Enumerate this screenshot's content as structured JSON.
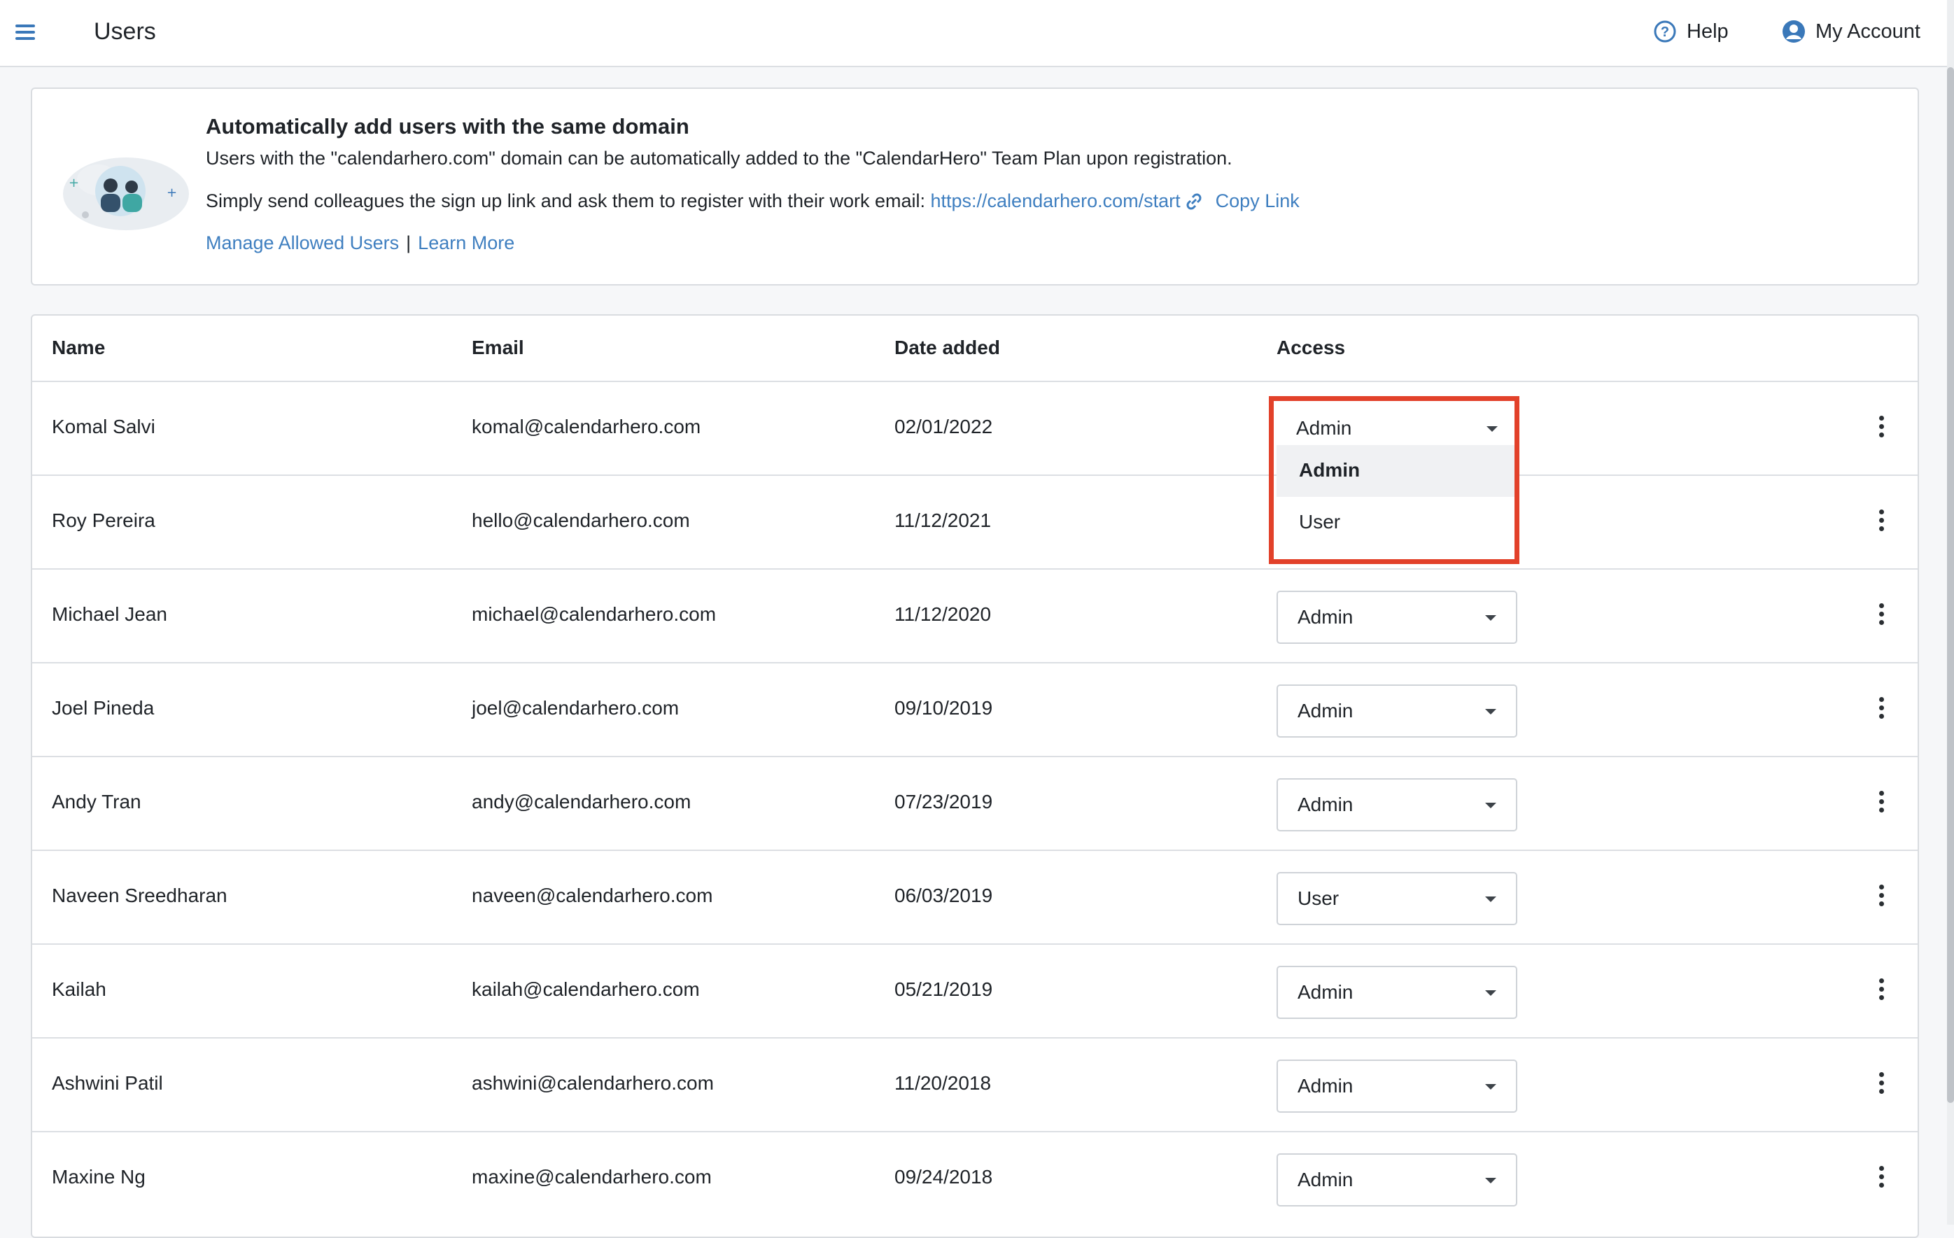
{
  "header": {
    "title": "Users",
    "help_label": "Help",
    "account_label": "My Account",
    "icons": {
      "menu": "hamburger-icon",
      "help": "question-circle-icon",
      "account": "user-circle-icon"
    }
  },
  "banner": {
    "title": "Automatically add users with the same domain",
    "line1": "Users with the \"calendarhero.com\" domain can be automatically added to the \"CalendarHero\" Team Plan upon registration.",
    "line2_prefix": "Simply send colleagues the sign up link and ask them to register with their work email: ",
    "signup_url": "https://calendarhero.com/start",
    "copy_link": "Copy Link",
    "manage_link": "Manage Allowed Users",
    "separator": "|",
    "learn_more": "Learn More"
  },
  "table": {
    "headers": {
      "name": "Name",
      "email": "Email",
      "date": "Date added",
      "access": "Access"
    },
    "rows": [
      {
        "name": "Komal Salvi",
        "email": "komal@calendarhero.com",
        "date": "02/01/2022",
        "access": "Admin"
      },
      {
        "name": "Roy Pereira",
        "email": "hello@calendarhero.com",
        "date": "11/12/2021",
        "access": ""
      },
      {
        "name": "Michael Jean",
        "email": "michael@calendarhero.com",
        "date": "11/12/2020",
        "access": "Admin"
      },
      {
        "name": "Joel Pineda",
        "email": "joel@calendarhero.com",
        "date": "09/10/2019",
        "access": "Admin"
      },
      {
        "name": "Andy Tran",
        "email": "andy@calendarhero.com",
        "date": "07/23/2019",
        "access": "Admin"
      },
      {
        "name": "Naveen Sreedharan",
        "email": "naveen@calendarhero.com",
        "date": "06/03/2019",
        "access": "User"
      },
      {
        "name": "Kailah",
        "email": "kailah@calendarhero.com",
        "date": "05/21/2019",
        "access": "Admin"
      },
      {
        "name": "Ashwini Patil",
        "email": "ashwini@calendarhero.com",
        "date": "11/20/2018",
        "access": "Admin"
      },
      {
        "name": "Maxine Ng",
        "email": "maxine@calendarhero.com",
        "date": "09/24/2018",
        "access": "Admin"
      }
    ]
  },
  "dropdown": {
    "options": [
      "Admin",
      "User"
    ],
    "selected": "Admin"
  },
  "colors": {
    "accent": "#3f7fc0",
    "highlight": "#e2412a"
  }
}
